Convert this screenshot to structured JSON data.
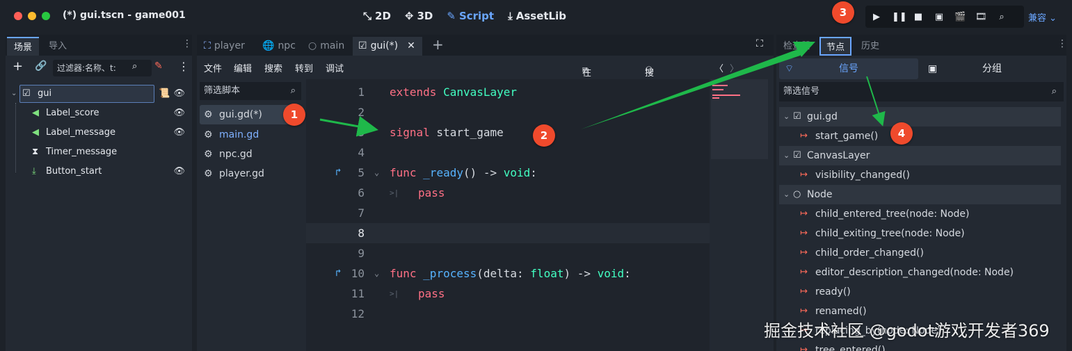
{
  "window": {
    "title": "(*) gui.tscn - game001",
    "modes": [
      {
        "label": "2D",
        "icon": "2d-icon",
        "active": false
      },
      {
        "label": "3D",
        "icon": "3d-icon",
        "active": false
      },
      {
        "label": "Script",
        "icon": "script-icon",
        "active": true
      },
      {
        "label": "AssetLib",
        "icon": "assetlib-icon",
        "active": false
      }
    ],
    "renderer": "兼容"
  },
  "scene_dock": {
    "tabs": [
      "场景",
      "导入"
    ],
    "filter_placeholder": "过滤器:名称、t:",
    "nodes": [
      {
        "label": "gui",
        "icon": "canvas-layer-icon",
        "visible_toggle": true
      },
      {
        "label": "Label_score",
        "icon": "label-icon",
        "visible_toggle": true
      },
      {
        "label": "Label_message",
        "icon": "label-icon",
        "visible_toggle": true
      },
      {
        "label": "Timer_message",
        "icon": "timer-icon",
        "visible_toggle": false
      },
      {
        "label": "Button_start",
        "icon": "button-icon",
        "visible_toggle": true
      }
    ]
  },
  "script_editor": {
    "tabs": [
      {
        "label": "player",
        "icon": "node2d-icon",
        "active": false
      },
      {
        "label": "npc",
        "icon": "globe-icon",
        "active": false
      },
      {
        "label": "main",
        "icon": "node-icon",
        "active": false
      },
      {
        "label": "gui(*)",
        "icon": "canvas-layer-icon",
        "active": true
      }
    ],
    "menu": [
      "文件",
      "编辑",
      "搜索",
      "转到",
      "调试"
    ],
    "online_docs": "在线文档",
    "search_help": "搜索帮助",
    "filter_placeholder": "筛选脚本",
    "scripts": [
      {
        "label": "gui.gd(*)",
        "selected": true
      },
      {
        "label": "main.gd",
        "selected": false
      },
      {
        "label": "npc.gd",
        "selected": false
      },
      {
        "label": "player.gd",
        "selected": false
      }
    ],
    "lines": [
      {
        "n": "1",
        "text": "extends CanvasLayer"
      },
      {
        "n": "2",
        "text": ""
      },
      {
        "n": "3",
        "text": "signal start_game"
      },
      {
        "n": "4",
        "text": ""
      },
      {
        "n": "5",
        "text": "func _ready() -> void:"
      },
      {
        "n": "6",
        "text": "pass"
      },
      {
        "n": "7",
        "text": ""
      },
      {
        "n": "8",
        "text": ""
      },
      {
        "n": "9",
        "text": ""
      },
      {
        "n": "10",
        "text": "func _process(delta: float) -> void:"
      },
      {
        "n": "11",
        "text": "pass"
      },
      {
        "n": "12",
        "text": ""
      }
    ]
  },
  "node_dock": {
    "tabs": [
      "检查器",
      "节点",
      "历史"
    ],
    "toggles": [
      "信号",
      "分组"
    ],
    "filter_placeholder": "筛选信号",
    "groups": [
      {
        "label": "gui.gd",
        "signals": [
          "start_game()"
        ]
      },
      {
        "label": "CanvasLayer",
        "signals": [
          "visibility_changed()"
        ]
      },
      {
        "label": "Node",
        "signals": [
          "child_entered_tree(node: Node)",
          "child_exiting_tree(node: Node)",
          "child_order_changed()",
          "editor_description_changed(node: Node)",
          "ready()",
          "renamed()",
          "replacing_by(node: Node)",
          "tree_entered()"
        ]
      }
    ]
  },
  "annotations": {
    "badges": [
      "1",
      "2",
      "3",
      "4"
    ],
    "accent": "#ef4a2c",
    "arrow_color": "#1fb84a"
  },
  "watermark": "掘金技术社区 @godot游戏开发者369",
  "colors": {
    "accent": "#6aa6ff",
    "keyword": "#ff7085",
    "type": "#42ffc2",
    "background": "#1d2229"
  }
}
